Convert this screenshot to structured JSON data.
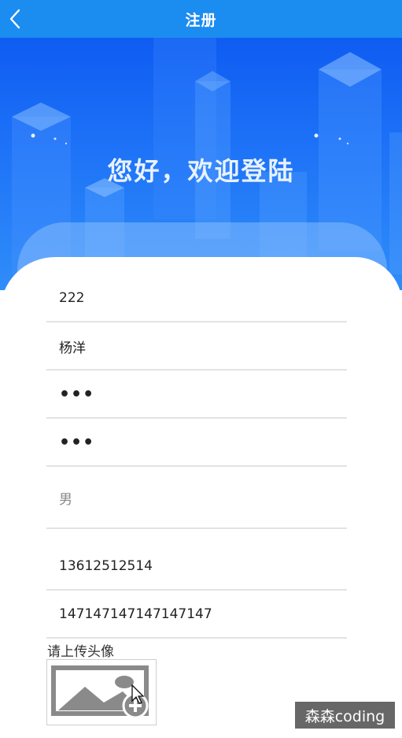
{
  "header": {
    "title": "注册",
    "back_icon": "chevron-left-icon",
    "background": "#1b8cf0"
  },
  "hero": {
    "greeting": "您好，欢迎登陆",
    "colors": {
      "top": "#0f5cf2",
      "bottom": "#2f8df8"
    }
  },
  "form": {
    "fields": [
      {
        "name": "username",
        "value": "222"
      },
      {
        "name": "real-name",
        "value": "杨洋"
      },
      {
        "name": "password",
        "value": "•••"
      },
      {
        "name": "confirm-password",
        "value": "•••"
      },
      {
        "name": "gender",
        "value": "男"
      },
      {
        "name": "phone",
        "value": "13612512514"
      },
      {
        "name": "id-number",
        "value": "147147147147147147"
      }
    ],
    "upload_label": "请上传头像",
    "upload_icon": "image-upload-icon"
  },
  "watermark": "森森coding"
}
